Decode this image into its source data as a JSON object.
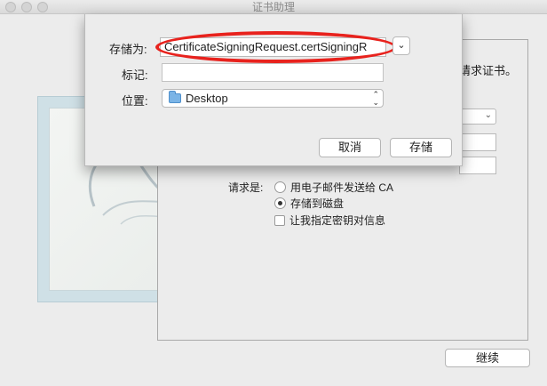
{
  "window": {
    "title": "证书助理"
  },
  "main": {
    "instruction_tail": "请求证书。",
    "request_is_label": "请求是:",
    "options": [
      {
        "label": "用电子邮件发送给 CA",
        "checked": false
      },
      {
        "label": "存储到磁盘",
        "checked": true
      }
    ],
    "custom_key_label": "让我指定密钥对信息",
    "custom_key_checked": false,
    "continue_label": "继续"
  },
  "save_sheet": {
    "save_as_label": "存储为:",
    "filename": "CertificateSigningRequest.certSigningR",
    "tags_label": "标记:",
    "tags_value": "",
    "where_label": "位置:",
    "where_value": "Desktop",
    "cancel_label": "取消",
    "save_label": "存储"
  },
  "colors": {
    "highlight_ring": "#e8221d",
    "folder": "#7bb4e6"
  },
  "icons": [
    "folder-icon",
    "chevron-down-icon",
    "updown-arrows-icon"
  ]
}
